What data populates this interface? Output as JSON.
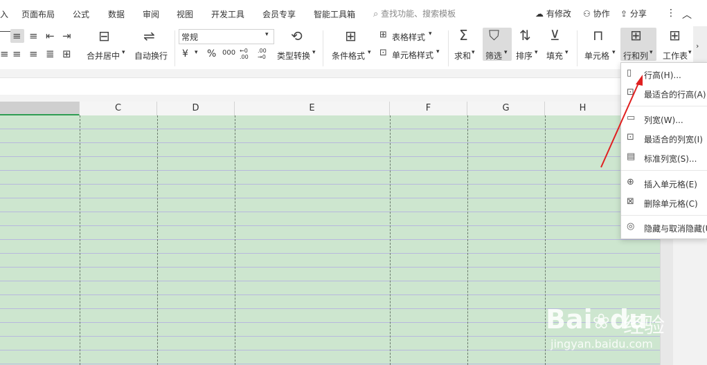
{
  "menubar": {
    "tabs": [
      "入",
      "页面布局",
      "公式",
      "数据",
      "审阅",
      "视图",
      "开发工具",
      "会员专享",
      "智能工具箱"
    ],
    "search_placeholder": "查找功能、搜索模板",
    "actions": [
      "有修改",
      "协作",
      "分享"
    ]
  },
  "ribbon": {
    "merge_label": "合并居中",
    "wrap_label": "自动换行",
    "number_format": "常规",
    "currency": "¥",
    "percent": "%",
    "thousands": "000",
    "dec_inc": "←0 .00",
    "dec_dec": ".00 →0",
    "type_convert_label": "类型转换",
    "cond_format_label": "条件格式",
    "table_style_label": "表格样式",
    "cell_style_label": "单元格样式",
    "sum_label": "求和",
    "filter_label": "筛选",
    "sort_label": "排序",
    "fill_label": "填充",
    "cell_label": "单元格",
    "rowcol_label": "行和列",
    "worksheet_label": "工作表"
  },
  "columns": [
    "C",
    "D",
    "E",
    "F",
    "G",
    "H"
  ],
  "context_menu": {
    "items": [
      {
        "label": "行高(H)...",
        "icon": "row-height-icon"
      },
      {
        "label": "最适合的行高(A)",
        "icon": "autofit-row-icon"
      },
      {
        "label": "列宽(W)...",
        "icon": "col-width-icon"
      },
      {
        "label": "最适合的列宽(I)",
        "icon": "autofit-col-icon"
      },
      {
        "label": "标准列宽(S)...",
        "icon": "std-col-icon"
      },
      {
        "label": "插入单元格(E)",
        "icon": "insert-cell-icon"
      },
      {
        "label": "删除单元格(C)",
        "icon": "delete-cell-icon"
      },
      {
        "label": "隐藏与取消隐藏(U",
        "icon": "hide-eye-icon"
      }
    ]
  },
  "watermark": {
    "brand": "Bai",
    "brand2": "du",
    "product": "经验",
    "url": "jingyan.baidu.com"
  },
  "colors": {
    "sheet_fill": "#cde6cf",
    "row_line": "#b7b8dd",
    "arrow": "#e02020"
  }
}
